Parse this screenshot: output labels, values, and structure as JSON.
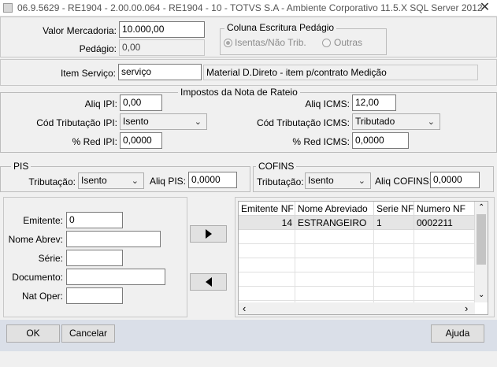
{
  "window": {
    "title": "06.9.5629 - RE1904 - 2.00.00.064 - RE1904 - 10 - TOTVS S.A - Ambiente Corporativo 11.5.X SQL Server 2012",
    "close_glyph": "✕"
  },
  "top": {
    "valor_mercadoria_label": "Valor Mercadoria:",
    "valor_mercadoria": "10.000,00",
    "pedagio_label": "Pedágio:",
    "pedagio": "0,00",
    "coluna_title": "Coluna Escritura Pedágio",
    "radio_isentas": "Isentas/Não Trib.",
    "radio_outras": "Outras"
  },
  "item": {
    "label": "Item Serviço:",
    "value": "serviço",
    "description": "Material D.Direto - item p/contrato Medição"
  },
  "impostos": {
    "title": "Impostos da Nota de Rateio",
    "aliq_ipi_label": "Aliq IPI:",
    "aliq_ipi": "0,00",
    "cod_trib_ipi_label": "Cód Tributação IPI:",
    "cod_trib_ipi": "Isento",
    "red_ipi_label": "% Red IPI:",
    "red_ipi": "0,0000",
    "aliq_icms_label": "Aliq ICMS:",
    "aliq_icms": "12,00",
    "cod_trib_icms_label": "Cód Tributação ICMS:",
    "cod_trib_icms": "Tributado",
    "red_icms_label": "% Red ICMS:",
    "red_icms": "0,0000"
  },
  "pis": {
    "title": "PIS",
    "trib_label": "Tributação:",
    "trib": "Isento",
    "aliq_label": "Aliq PIS:",
    "aliq": "0,0000"
  },
  "cofins": {
    "title": "COFINS",
    "trib_label": "Tributação:",
    "trib": "Isento",
    "aliq_label": "Aliq COFINS:",
    "aliq": "0,0000"
  },
  "filter": {
    "emitente_label": "Emitente:",
    "emitente": "0",
    "nome_abrev_label": "Nome Abrev:",
    "nome_abrev": "",
    "serie_label": "Série:",
    "serie": "",
    "documento_label": "Documento:",
    "documento": "",
    "nat_oper_label": "Nat Oper:",
    "nat_oper": ""
  },
  "grid": {
    "columns": [
      "Emitente NF",
      "Nome Abreviado",
      "Serie NF",
      "Numero NF"
    ],
    "rows": [
      [
        "14",
        "ESTRANGEIRO",
        "1",
        "0002211"
      ]
    ]
  },
  "buttons": {
    "ok": "OK",
    "cancelar": "Cancelar",
    "ajuda": "Ajuda"
  }
}
